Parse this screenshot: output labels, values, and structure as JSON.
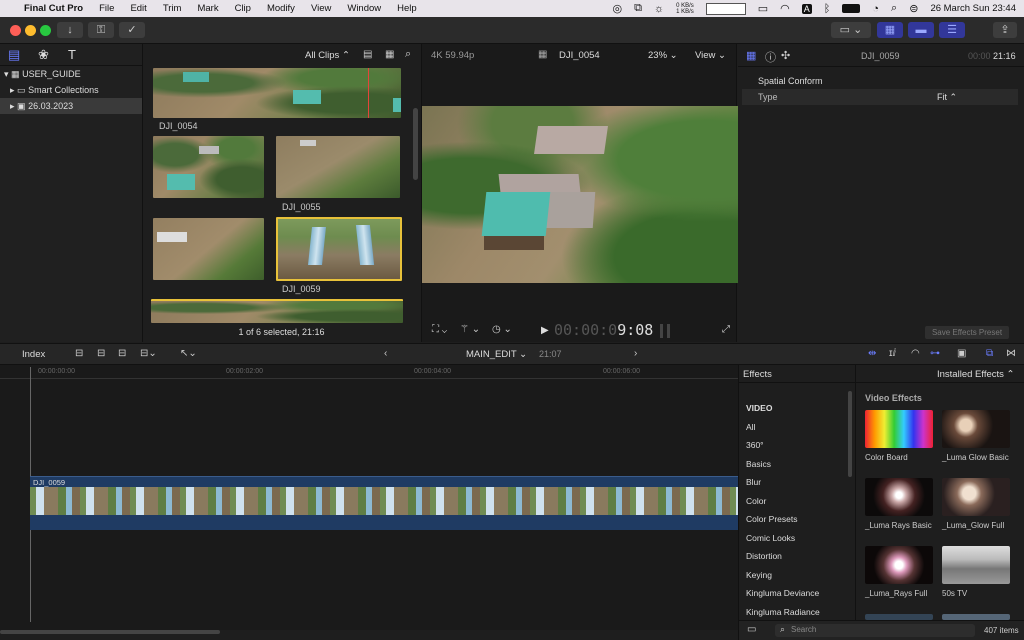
{
  "menubar": {
    "app_name": "Final Cut Pro",
    "items": [
      "File",
      "Edit",
      "Trim",
      "Mark",
      "Clip",
      "Modify",
      "View",
      "Window",
      "Help"
    ],
    "net_up": "0 KB/s",
    "net_down": "1 KB/s",
    "datetime": "26 March Sun  23:44"
  },
  "library": {
    "name": "USER_GUIDE",
    "smart_collections": "Smart Collections",
    "event": "26.03.2023"
  },
  "browser": {
    "filter": "All Clips ⌃",
    "clips": [
      {
        "label": "DJI_0054"
      },
      {
        "label": ""
      },
      {
        "label": "DJI_0055"
      },
      {
        "label": ""
      },
      {
        "label": "DJI_0059"
      }
    ],
    "status": "1 of 6 selected, 21:16"
  },
  "viewer": {
    "format": "4K 59.94p",
    "clip_name": "DJI_0054",
    "zoom": "23%",
    "view_label": "View",
    "timecode_dim": "00:00:0",
    "timecode": "9:08"
  },
  "inspector": {
    "clip_name": "DJI_0059",
    "duration_dim": "00:00",
    "duration": "21:16",
    "section": "Spatial Conform",
    "type_label": "Type",
    "type_value": "Fit ⌃",
    "save_preset": "Save Effects Preset"
  },
  "timeline_bar": {
    "index": "Index",
    "project": "MAIN_EDIT",
    "duration": "21:07",
    "ruler": [
      "00:00:00:00",
      "00:00:02:00",
      "00:00:04:00",
      "00:00:06:00"
    ]
  },
  "timeline": {
    "clip_name": "DJI_0059"
  },
  "effects": {
    "title": "Effects",
    "installed": "Installed Effects ⌃",
    "section": "Video Effects",
    "categories": [
      "VIDEO",
      "All",
      "360°",
      "Basics",
      "Blur",
      "Color",
      "Color Presets",
      "Comic Looks",
      "Distortion",
      "Keying",
      "Kingluma Deviance",
      "Kingluma Radiance"
    ],
    "tiles": [
      "Color Board",
      "_Luma Glow Basic",
      "_Luma Rays Basic",
      "_Luma_Glow Full",
      "_Luma_Rays Full",
      "50s TV"
    ],
    "search_placeholder": "Search",
    "count": "407 items"
  },
  "colors": {
    "accent_blue": "#5a6cf0",
    "selection_yellow": "#e8c23a",
    "clip_blue": "#1f3b63"
  }
}
